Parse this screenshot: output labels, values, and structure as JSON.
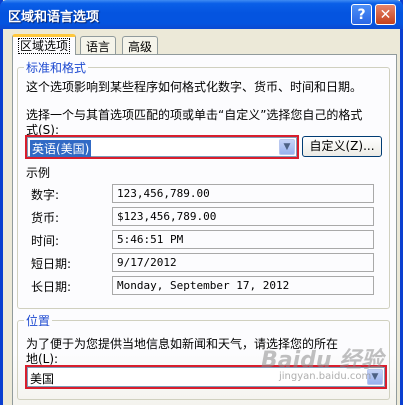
{
  "window": {
    "title": "区域和语言选项",
    "help_label": "?",
    "close_label": "✕"
  },
  "tabs": [
    {
      "label": "区域选项",
      "active": true
    },
    {
      "label": "语言",
      "active": false
    },
    {
      "label": "高级",
      "active": false
    }
  ],
  "standards": {
    "group_title": "标准和格式",
    "description": "这个选项影响到某些程序如何格式化数字、货币、时间和日期。",
    "instruction_line1": "选择一个与其首选项匹配的项或单击“自定义”选择您自己的格式",
    "instruction_line2": "式(S):",
    "selected_format": "英语(美国)",
    "customize_label": "自定义(Z)..."
  },
  "samples": {
    "title": "示例",
    "rows": [
      {
        "label": "数字:",
        "value": "123,456,789.00"
      },
      {
        "label": "货币:",
        "value": "$123,456,789.00"
      },
      {
        "label": "时间:",
        "value": "5:46:51 PM"
      },
      {
        "label": "短日期:",
        "value": "9/17/2012"
      },
      {
        "label": "长日期:",
        "value": "Monday, September 17, 2012"
      }
    ]
  },
  "location": {
    "group_title": "位置",
    "instruction_line1": "为了便于为您提供当地信息如新闻和天气，请选择您的所在",
    "instruction_line2": "地(L):",
    "selected": "美国"
  },
  "watermark": {
    "text": "Baidu 经验",
    "sub": "jingyan.baidu.com"
  },
  "colors": {
    "title_bar": "#0454e0",
    "window_border": "#0a3fd0",
    "group_title": "#1e4ad0",
    "highlight_box": "#d81e2d",
    "selection": "#316ac5",
    "active_tab_accent": "#ffc83c"
  }
}
